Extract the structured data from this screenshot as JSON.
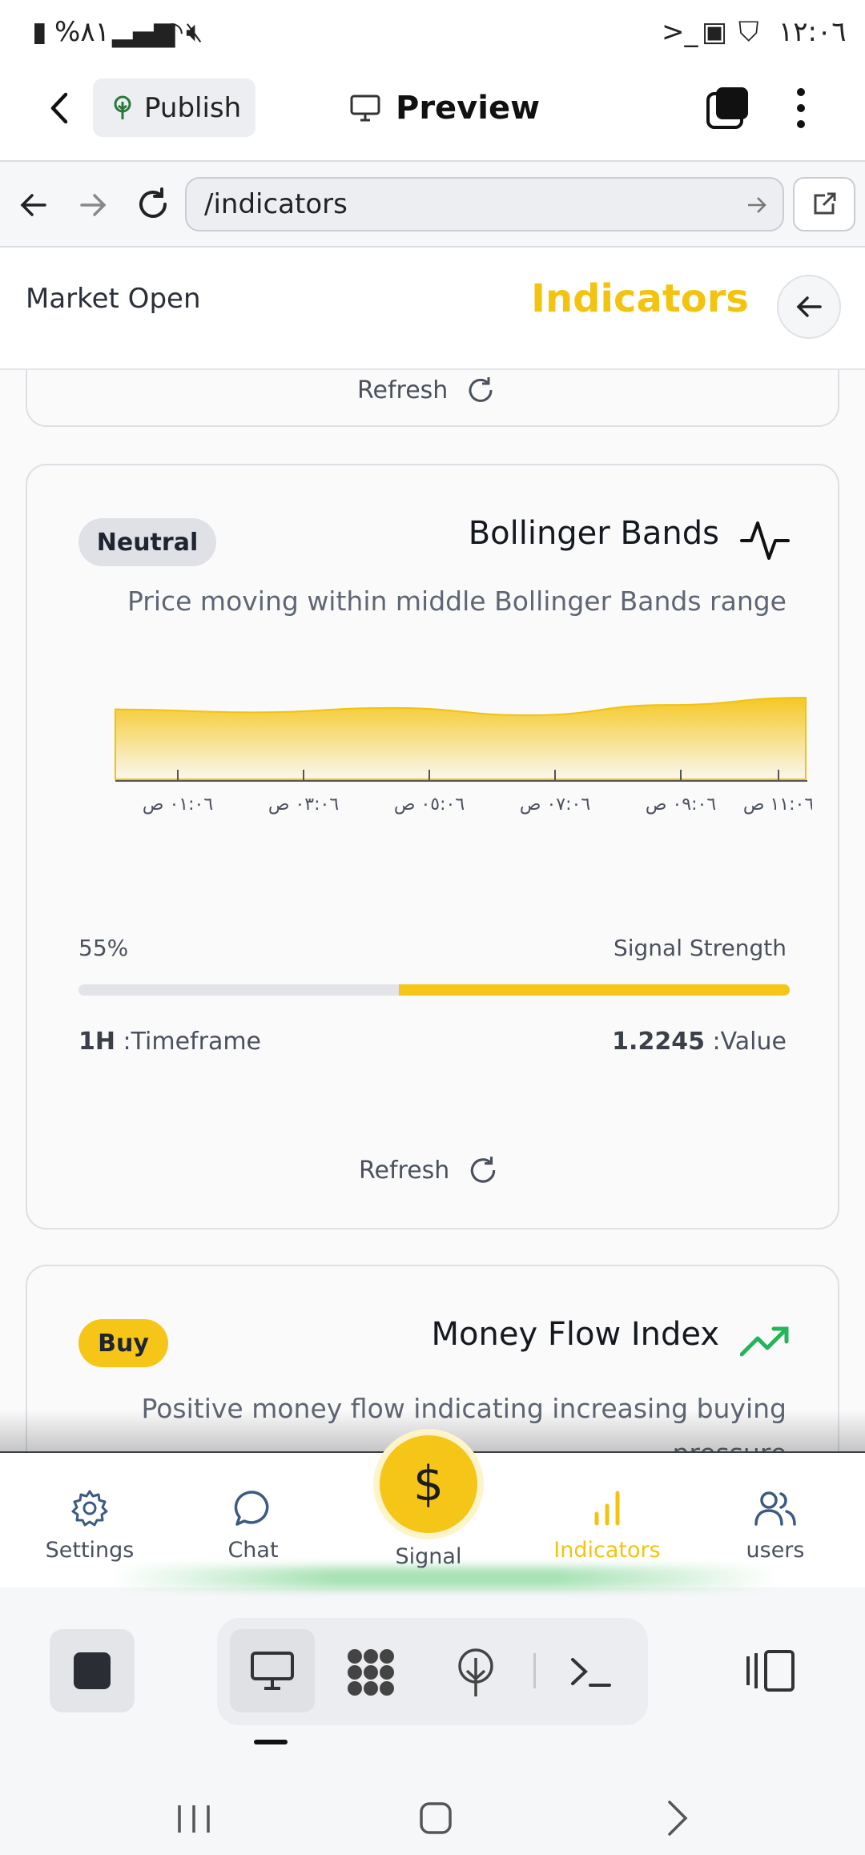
{
  "status_bar": {
    "battery": "%٨١",
    "time": "١٢:٠٦"
  },
  "app_bar": {
    "publish_label": "Publish",
    "preview_label": "Preview"
  },
  "browser": {
    "url": "/indicators"
  },
  "page_header": {
    "market_status": "Market Open",
    "title": "Indicators"
  },
  "cards": {
    "prev_refresh_label": "Refresh",
    "bollinger": {
      "badge": "Neutral",
      "title": "Bollinger Bands",
      "description": "Price moving within middle Bollinger Bands range",
      "signal_label": "Signal Strength",
      "signal_percent": "55%",
      "signal_fraction": 0.55,
      "value_label": ":Value",
      "value": "1.2245",
      "timeframe_label": ":Timeframe",
      "timeframe": "1H",
      "refresh_label": "Refresh"
    },
    "mfi": {
      "badge": "Buy",
      "title": "Money Flow Index",
      "description": "Positive money flow indicating increasing buying pressure"
    }
  },
  "chart_data": {
    "type": "area",
    "x": [
      "٠١:٠٦ ص",
      "٠٣:٠٦ ص",
      "٠٥:٠٦ ص",
      "٠٧:٠٦ ص",
      "٠٩:٠٦ ص",
      "١١:٠٦ ص"
    ],
    "values": [
      1.2238,
      1.2236,
      1.2239,
      1.2234,
      1.2241,
      1.2246
    ],
    "color": "#f5c518"
  },
  "bottom_nav": {
    "settings": "Settings",
    "chat": "Chat",
    "signal": "Signal",
    "indicators": "Indicators",
    "users": "users"
  },
  "colors": {
    "accent": "#f5c518",
    "buy_badge": "#f5c518",
    "neutral_badge": "#dfe1e6",
    "trend_up": "#22b55a"
  }
}
